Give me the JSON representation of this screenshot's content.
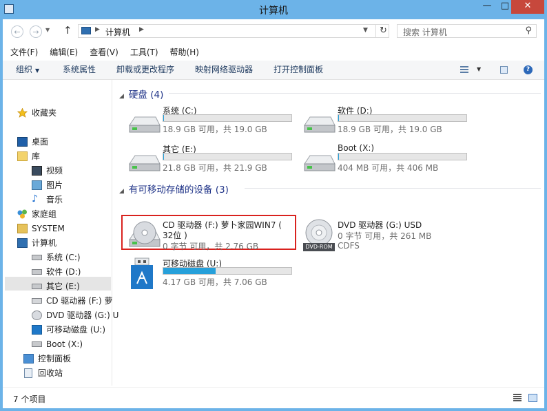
{
  "window": {
    "title": "计算机",
    "min_glyph": "—",
    "max_glyph": "□",
    "close_glyph": "✕"
  },
  "address": {
    "path_root": "计算机",
    "search_placeholder": "搜索 计算机"
  },
  "menu": [
    "文件(F)",
    "编辑(E)",
    "查看(V)",
    "工具(T)",
    "帮助(H)"
  ],
  "toolbar": {
    "organize": "组织",
    "system_properties": "系统属性",
    "uninstall": "卸载或更改程序",
    "map_drive": "映射网络驱动器",
    "control_panel": "打开控制面板"
  },
  "nav": {
    "favorites": "收藏夹",
    "desktop": "桌面",
    "libraries": "库",
    "videos": "视频",
    "pictures": "图片",
    "music": "音乐",
    "homegroup": "家庭组",
    "system": "SYSTEM",
    "computer": "计算机",
    "drive_c": "系统 (C:)",
    "drive_d": "软件 (D:)",
    "drive_e": "其它 (E:)",
    "drive_f": "CD 驱动器 (F:) 萝",
    "drive_g": "DVD 驱动器 (G:) U",
    "drive_u": "可移动磁盘 (U:)",
    "drive_x": "Boot (X:)",
    "control_panel": "控制面板",
    "recycle_bin": "回收站"
  },
  "groups": {
    "hard_disks": "硬盘 (4)",
    "removable": "有可移动存储的设备 (3)"
  },
  "drives": {
    "c": {
      "name": "系统 (C:)",
      "info": "18.9 GB 可用，共 19.0 GB",
      "used_fraction": 0.005
    },
    "d": {
      "name": "软件 (D:)",
      "info": "18.9 GB 可用，共 19.0 GB",
      "used_fraction": 0.005
    },
    "e": {
      "name": "其它 (E:)",
      "info": "21.8 GB 可用，共 21.9 GB",
      "used_fraction": 0.005
    },
    "x": {
      "name": "Boot (X:)",
      "info": "404 MB 可用，共 406 MB",
      "used_fraction": 0.005
    },
    "f": {
      "name_line1": "CD 驱动器 (F:) 萝卜家园WIN7 (",
      "name_line2": "32位 )",
      "info": "0 字节 可用，共 2.76 GB"
    },
    "g": {
      "name": "DVD 驱动器 (G:) USD",
      "info": "0 字节 可用，共 261 MB",
      "fs": "CDFS",
      "icon_label": "DVD-ROM"
    },
    "u": {
      "name": "可移动磁盘 (U:)",
      "info": "4.17 GB 可用，共 7.06 GB",
      "used_fraction": 0.41
    }
  },
  "status": {
    "items": "7 个项目"
  },
  "colors": {
    "accent": "#26a0da",
    "title_bar": "#6cb3e8",
    "highlight": "#d9221e",
    "group_header": "#1e3287"
  }
}
